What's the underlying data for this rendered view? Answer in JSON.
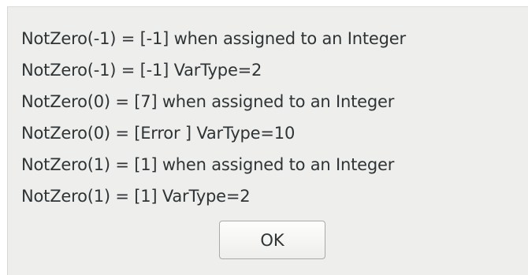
{
  "dialog": {
    "lines": [
      "NotZero(-1) = [-1] when assigned to an Integer",
      "NotZero(-1) = [-1] VarType=2",
      "NotZero(0) = [7] when assigned to an Integer",
      "NotZero(0) = [Error ] VarType=10",
      "NotZero(1) = [1] when assigned to an Integer",
      "NotZero(1) = [1] VarType=2"
    ],
    "ok_label": "OK"
  }
}
